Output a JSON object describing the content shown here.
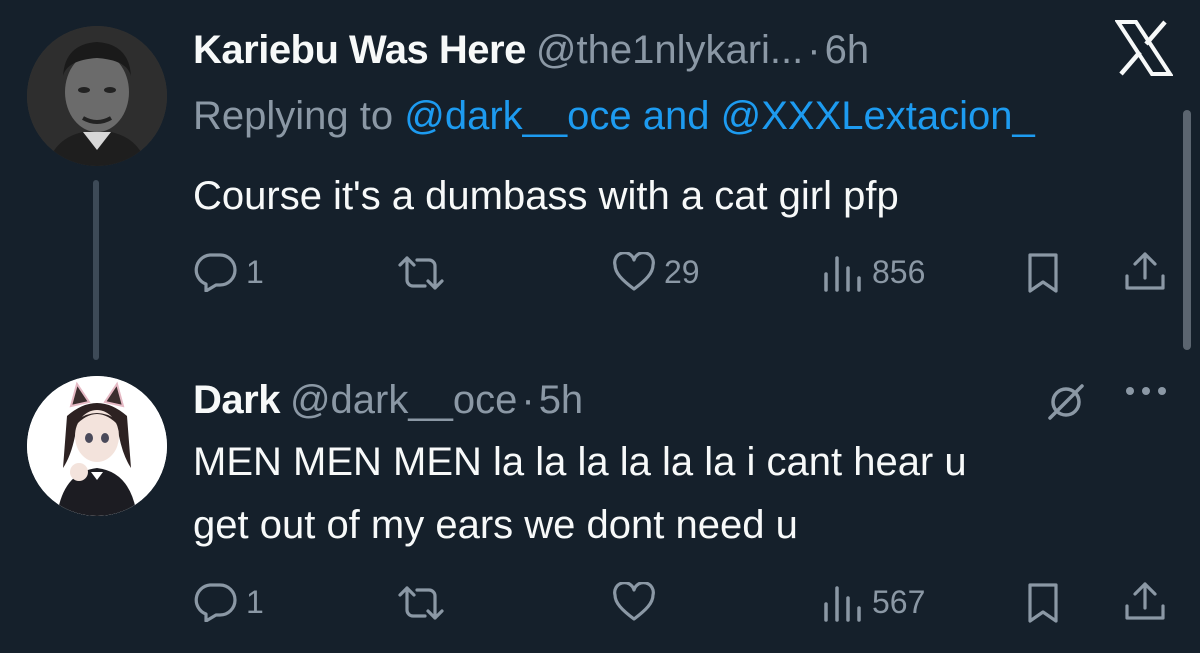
{
  "tweets": [
    {
      "display_name": "Kariebu Was Here",
      "handle": "@the1nlykari...",
      "separator": "·",
      "time": "6h",
      "replying_prefix": "Replying to",
      "replying_users": "@dark__oce and @XXXLextacion_",
      "text": "Course it's a dumbass with a cat girl pfp",
      "replies": "1",
      "retweets": "",
      "likes": "29",
      "views": "856",
      "avatar_icon": "man-avatar"
    },
    {
      "display_name": "Dark",
      "handle": "@dark__oce",
      "separator": "·",
      "time": "5h",
      "text_line1": "MEN MEN MEN la la la la la la i cant hear u",
      "text_line2": "get out of my ears we dont need u",
      "replies": "1",
      "retweets": "",
      "likes": "",
      "views": "567",
      "avatar_icon": "anime-cat-girl-avatar"
    }
  ],
  "icons": {
    "reply": "reply-icon",
    "retweet": "retweet-icon",
    "like": "heart-icon",
    "views": "views-icon",
    "bookmark": "bookmark-icon",
    "share": "share-icon",
    "logo": "x-logo-icon",
    "more": "more-icon",
    "mute": "muted-icon"
  },
  "colors": {
    "background": "#15202b",
    "text": "#f7f9f9",
    "secondary": "#8b98a5",
    "link": "#1d9bf0"
  }
}
